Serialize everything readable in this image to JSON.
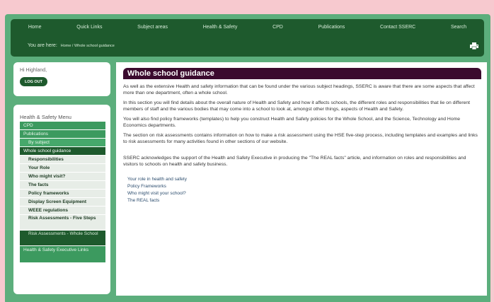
{
  "nav": {
    "items": [
      "Home",
      "Quick Links",
      "Subject areas",
      "Health & Safety",
      "CPD",
      "Publications",
      "Contact SSERC",
      "Search"
    ]
  },
  "breadcrumb": {
    "prefix": "You are here:",
    "path": "Home / Whole school guidance"
  },
  "login": {
    "greeting": "Hi Highland,",
    "logout_label": "LOG OUT"
  },
  "menu": {
    "title": "Health & Safety Menu",
    "cpd": "CPD",
    "publications": "Publications",
    "by_subject": "By subject",
    "active": "Whole school guidance",
    "children": [
      "Responsibilities",
      "Your Role",
      "Who might visit?",
      "The facts",
      "Policy frameworks",
      "Display Screen Equipment",
      "WEEE regulations",
      "Risk Assessments - Five Steps",
      "Risk Assessments - Whole School"
    ],
    "hse_links": "Health & Safety Executive Links"
  },
  "content": {
    "title": "Whole school guidance",
    "paragraphs": [
      "As well as the extensive Health and safety information that can be found under the various subject headings, SSERC is aware that there are some aspects that affect more than one department, often a whole school.",
      "In this section you will find details about the overall nature of Health and Safety and how it affects schools, the different roles and responsibilities that lie on different members of staff and the various bodies that may come into a school to look at, amongst other things, aspects of Health and Safety.",
      "You will also find policy frameworks (templates) to help you construct Health and Safety policies for the Whole School, and the Science, Technology and Home Economics departments.",
      "The section on risk assessments contains information on how to make a risk assessment using the HSE five-step process, including templates and examples and links to risk assessments for many activities found in other sections of our website.",
      "SSERC acknowledges the support of the Health and Safety Executive in producing the \"The REAL facts\" article, and information on roles and responsibilities and visitors to schools on health and safety business."
    ],
    "links": [
      "Your role in health and safety",
      "Policy Frameworks",
      "Who might visit your school?",
      "The REAL facts"
    ]
  },
  "colors": {
    "page_bg": "#f7c9cf",
    "frame": "#5cae7c",
    "nav_bar": "#1e5a2d",
    "heading_bg": "#3b0a2e"
  },
  "icons": {
    "print": "printer-icon"
  }
}
